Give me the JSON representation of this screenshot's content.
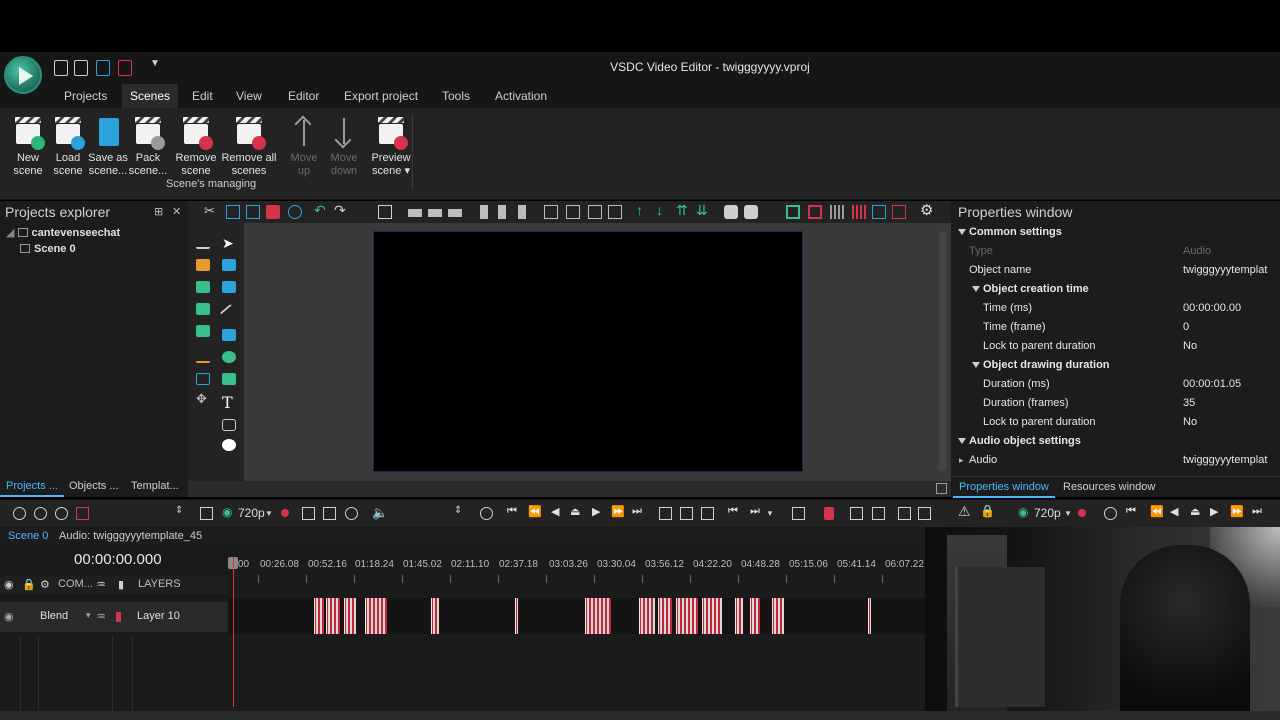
{
  "window": {
    "title": "VSDC Video Editor - twigggyyyy.vproj"
  },
  "menu": {
    "items": [
      {
        "label": "Projects"
      },
      {
        "label": "Scenes"
      },
      {
        "label": "Edit"
      },
      {
        "label": "View"
      },
      {
        "label": "Editor"
      },
      {
        "label": "Export project"
      },
      {
        "label": "Tools"
      },
      {
        "label": "Activation"
      }
    ],
    "active": "Scenes"
  },
  "ribbon": {
    "group_label": "Scene's managing",
    "buttons": [
      {
        "label_1": "New",
        "label_2": "scene",
        "icon": "new-scene-icon"
      },
      {
        "label_1": "Load",
        "label_2": "scene",
        "icon": "load-scene-icon"
      },
      {
        "label_1": "Save as",
        "label_2": "scene...",
        "icon": "save-scene-icon"
      },
      {
        "label_1": "Pack",
        "label_2": "scene...",
        "icon": "pack-scene-icon"
      },
      {
        "label_1": "Remove",
        "label_2": "scene",
        "icon": "remove-scene-icon"
      },
      {
        "label_1": "Remove all",
        "label_2": "scenes",
        "icon": "remove-all-scenes-icon"
      },
      {
        "label_1": "Move",
        "label_2": "up",
        "icon": "arrow-up-icon"
      },
      {
        "label_1": "Move",
        "label_2": "down",
        "icon": "arrow-down-icon"
      },
      {
        "label_1": "Preview",
        "label_2": "scene ▾",
        "icon": "preview-scene-icon"
      }
    ]
  },
  "projects_explorer": {
    "title": "Projects explorer",
    "pin": "⊞",
    "close": "✕",
    "tree": [
      {
        "label": "cantevenseechat"
      },
      {
        "label": "Scene 0"
      }
    ],
    "tabs": [
      {
        "label": "Projects ..."
      },
      {
        "label": "Objects ..."
      },
      {
        "label": "Templat..."
      }
    ]
  },
  "properties": {
    "title": "Properties window",
    "rows": [
      {
        "key": "Common settings",
        "value": ""
      },
      {
        "key": "Type",
        "value": "Audio"
      },
      {
        "key": "Object name",
        "value": "twigggyyytemplat"
      },
      {
        "key": "Object creation time",
        "value": ""
      },
      {
        "key": "Time (ms)",
        "value": "00:00:00.00"
      },
      {
        "key": "Time (frame)",
        "value": "0"
      },
      {
        "key": "Lock to parent duration",
        "value": "No"
      },
      {
        "key": "Object drawing duration",
        "value": ""
      },
      {
        "key": "Duration (ms)",
        "value": "00:00:01.05"
      },
      {
        "key": "Duration (frames)",
        "value": "35"
      },
      {
        "key": "Lock to parent duration",
        "value": "No"
      },
      {
        "key": "Audio object settings",
        "value": ""
      },
      {
        "key": "Audio",
        "value": "twigggyyytemplat"
      }
    ],
    "tabs": [
      {
        "label": "Properties window"
      },
      {
        "label": "Resources window"
      }
    ]
  },
  "timeline": {
    "resolution": "720p",
    "resolution_right": "720p",
    "tabs": [
      {
        "label": "Scene 0"
      },
      {
        "label": "Audio: twigggyyytemplate_45"
      }
    ],
    "timecode": "00:00:00.000",
    "layers_header": {
      "com": "COM...",
      "layers": "LAYERS"
    },
    "layer": {
      "blend": "Blend",
      "name": "Layer 10"
    },
    "ruler_labels": [
      "00",
      "00:26.08",
      "00:52.16",
      "01:18.24",
      "01:45.02",
      "02:11.10",
      "02:37.18",
      "03:03.26",
      "03:30.04",
      "03:56.12",
      "04:22.20",
      "04:48.28",
      "05:15.06",
      "05:41.14",
      "06:07.22"
    ]
  },
  "colors": {
    "accent_blue": "#4ab8ff",
    "clip_red": "#d82a3a",
    "playhead_red": "#e03040"
  }
}
